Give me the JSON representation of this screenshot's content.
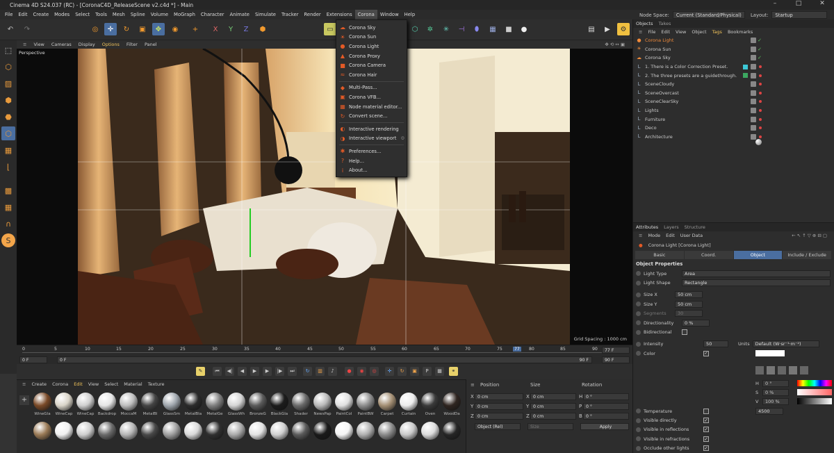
{
  "window": {
    "title": "Cinema 4D S24.037 (RC) - [CoronaC4D_ReleaseScene v2.c4d *] - Main",
    "controls": [
      "–",
      "□",
      "✕"
    ]
  },
  "menubar": {
    "items": [
      "File",
      "Edit",
      "Create",
      "Modes",
      "Select",
      "Tools",
      "Mesh",
      "Spline",
      "Volume",
      "MoGraph",
      "Character",
      "Animate",
      "Simulate",
      "Tracker",
      "Render",
      "Extensions",
      "Corona",
      "Window",
      "Help"
    ],
    "active": "Corona",
    "node_space_label": "Node Space:",
    "node_space_value": "Current (Standard/Physical)",
    "layout_label": "Layout:",
    "layout_value": "Startup"
  },
  "corona_menu": {
    "items": [
      {
        "label": "Corona Sky",
        "icon": "sky-icon",
        "glyph": "☁"
      },
      {
        "label": "Corona Sun",
        "icon": "sun-icon",
        "glyph": "☀"
      },
      {
        "label": "Corona Light",
        "icon": "light-icon",
        "glyph": "●"
      },
      {
        "label": "Corona Proxy",
        "icon": "proxy-icon",
        "glyph": "▲"
      },
      {
        "label": "Corona Camera",
        "icon": "camera-icon",
        "glyph": "■"
      },
      {
        "label": "Corona Hair",
        "icon": "hair-icon",
        "glyph": "≈"
      },
      {
        "sep": true
      },
      {
        "label": "Multi-Pass...",
        "icon": "multipass-icon",
        "glyph": "◆"
      },
      {
        "label": "Corona VFB...",
        "icon": "vfb-icon",
        "glyph": "▣"
      },
      {
        "label": "Node material editor...",
        "icon": "node-editor-icon",
        "glyph": "▦"
      },
      {
        "label": "Convert scene...",
        "icon": "convert-icon",
        "glyph": "↻"
      },
      {
        "sep": true
      },
      {
        "label": "Interactive rendering",
        "icon": "interactive-render-icon",
        "glyph": "◐"
      },
      {
        "label": "Interactive viewport",
        "icon": "interactive-viewport-icon",
        "glyph": "◑"
      },
      {
        "sep": true
      },
      {
        "label": "Preferences...",
        "icon": "preferences-icon",
        "glyph": "✱"
      },
      {
        "label": "Help...",
        "icon": "help-icon",
        "glyph": "?"
      },
      {
        "label": "About...",
        "icon": "about-icon",
        "glyph": "i"
      }
    ]
  },
  "viewport": {
    "menu": [
      "View",
      "Cameras",
      "Display",
      "Options",
      "Filter",
      "Panel"
    ],
    "label": "Perspective",
    "grid_spacing": "Grid Spacing : 1000 cm"
  },
  "timeline": {
    "ticks": [
      "0",
      "5",
      "10",
      "15",
      "20",
      "25",
      "30",
      "35",
      "40",
      "45",
      "50",
      "55",
      "60",
      "65",
      "70",
      "75",
      "77",
      "80",
      "85",
      "90"
    ],
    "current_frame": "77 F",
    "start_a": "0 F",
    "start_b": "0 F",
    "end_a": "90 F",
    "end_b": "90 F",
    "end_c": "90 F"
  },
  "material_panel": {
    "menu": [
      "Create",
      "Corona",
      "Edit",
      "View",
      "Select",
      "Material",
      "Texture"
    ],
    "row1": [
      {
        "name": "WineGla",
        "color": "#7a4a28"
      },
      {
        "name": "WineCap",
        "color": "#d9d4c8"
      },
      {
        "name": "WineCap",
        "color": "#cfcfcf"
      },
      {
        "name": "Backdrop",
        "color": "#e6e6e6"
      },
      {
        "name": "MoccaM",
        "color": "#bdbdbd"
      },
      {
        "name": "MetalBl",
        "color": "#444444"
      },
      {
        "name": "GlassSm",
        "color": "#9fa6ad"
      },
      {
        "name": "MetalBla",
        "color": "#2b2b2b"
      },
      {
        "name": "MetalGe",
        "color": "#7f7f7f"
      },
      {
        "name": "GlassWh",
        "color": "#d5d5d5"
      },
      {
        "name": "BronzeG",
        "color": "#5a5a5a"
      },
      {
        "name": "BlackGla",
        "color": "#1c1c1c"
      },
      {
        "name": "Shader",
        "color": "#6a6a6a"
      },
      {
        "name": "NewsPap",
        "color": "#b9b9b9"
      },
      {
        "name": "PaintCol",
        "color": "#e0e0e0"
      },
      {
        "name": "PaintBW",
        "color": "#8d8d8d"
      },
      {
        "name": "Carpet",
        "color": "#a48f74"
      },
      {
        "name": "Curtain",
        "color": "#ededed"
      },
      {
        "name": "Oven",
        "color": "#3a3a3a"
      },
      {
        "name": "WoodDa",
        "color": "#2f2520"
      }
    ],
    "row2": [
      "#9a7a56",
      "#f0f0f0",
      "#cfcfcf",
      "#6a6a6a",
      "#b5b5b5",
      "#484848",
      "#9f9f9f",
      "#d9d9d9",
      "#303030",
      "#aaaaaa",
      "#e2e2e2",
      "#d0d0d0",
      "#5a5a5a",
      "#1a1a1a",
      "#f5f5f5",
      "#b0b0b0",
      "#8a8a8a",
      "#c9c9c9",
      "#dcdcdc",
      "#262626"
    ]
  },
  "coords": {
    "headers": [
      "Position",
      "Size",
      "Rotation"
    ],
    "rows": [
      {
        "axis": "X",
        "pos": "0 cm",
        "size_axis": "X",
        "size": "0 cm",
        "rot_axis": "H",
        "rot": "0 °"
      },
      {
        "axis": "Y",
        "pos": "0 cm",
        "size_axis": "Y",
        "size": "0 cm",
        "rot_axis": "P",
        "rot": "0 °"
      },
      {
        "axis": "Z",
        "pos": "0 cm",
        "size_axis": "Z",
        "size": "0 cm",
        "rot_axis": "B",
        "rot": "0 °"
      }
    ],
    "mode": "Object (Rel)",
    "size_mode": "Size",
    "apply": "Apply"
  },
  "objects_panel": {
    "tabs": [
      "Objects",
      "Takes"
    ],
    "menu": [
      "File",
      "Edit",
      "View",
      "Object",
      "Tags",
      "Bookmarks"
    ],
    "items": [
      {
        "name": "Corona Light",
        "icon": "corona-light-icon",
        "glyph": "●",
        "color": "#f08a3a",
        "state": "check"
      },
      {
        "name": "Corona Sun",
        "icon": "corona-sun-icon",
        "glyph": "☀",
        "color": "#f08a3a",
        "state": "check"
      },
      {
        "name": "Corona Sky",
        "icon": "corona-sky-icon",
        "glyph": "☁",
        "color": "#f08a3a",
        "state": "check"
      },
      {
        "name": "1.  There is a Color Correction Preset.",
        "icon": "null-icon",
        "glyph": "L",
        "color": "#9ab",
        "state": "dot",
        "tag": "#3cc8d6"
      },
      {
        "name": "2.  The three presets are a guidethrough.",
        "icon": "null-icon",
        "glyph": "L",
        "color": "#9ab",
        "state": "dot",
        "tag": "#3ca860"
      },
      {
        "name": "SceneCloudy",
        "icon": "null-icon",
        "glyph": "L",
        "color": "#9ab",
        "state": "dot"
      },
      {
        "name": "SceneOvercast",
        "icon": "null-icon",
        "glyph": "L",
        "color": "#9ab",
        "state": "dot"
      },
      {
        "name": "SceneClearSky",
        "icon": "null-icon",
        "glyph": "L",
        "color": "#9ab",
        "state": "dot"
      },
      {
        "name": "Lights",
        "icon": "null-icon",
        "glyph": "L",
        "color": "#9ab",
        "state": "dot"
      },
      {
        "name": "Furniture",
        "icon": "null-icon",
        "glyph": "L",
        "color": "#9ab",
        "state": "dot"
      },
      {
        "name": "Deco",
        "icon": "null-icon",
        "glyph": "L",
        "color": "#9ab",
        "state": "dot"
      },
      {
        "name": "Architecture",
        "icon": "null-icon",
        "glyph": "L",
        "color": "#9ab",
        "state": "dot"
      }
    ]
  },
  "attributes": {
    "tabs": [
      "Attributes",
      "Layers",
      "Structure"
    ],
    "menu": [
      "Mode",
      "Edit",
      "User Data"
    ],
    "object_title": "Corona Light [Corona Light]",
    "subtabs": [
      "Basic",
      "Coord.",
      "Object",
      "Include / Exclude"
    ],
    "active_subtab": "Object",
    "section": "Object Properties",
    "light_type_label": "Light Type",
    "light_type": "Area",
    "light_shape_label": "Light Shape",
    "light_shape": "Rectangle",
    "size_x_label": "Size X",
    "size_x": "50 cm",
    "size_y_label": "Size Y",
    "size_y": "50 cm",
    "segments_label": "Segments",
    "segments": "30",
    "directionality_label": "Directionality",
    "directionality": "0 %",
    "bidirectional_label": "Bidirectional",
    "intensity_label": "Intensity",
    "intensity": "50",
    "units_label": "Units",
    "units": "Default (W·sr⁻¹·m⁻²)",
    "color_label": "Color",
    "h_label": "H",
    "h": "0 °",
    "s_label": "S",
    "s": "0 %",
    "v_label": "V",
    "v": "100 %",
    "temperature_label": "Temperature",
    "temperature": "4500",
    "visible_directly": "Visible directly",
    "visible_reflections": "Visible in reflections",
    "visible_refractions": "Visible in refractions",
    "occlude": "Occlude other lights"
  },
  "colors": {
    "accent": "#4a6ea0",
    "corona_orange": "#e35a26"
  }
}
